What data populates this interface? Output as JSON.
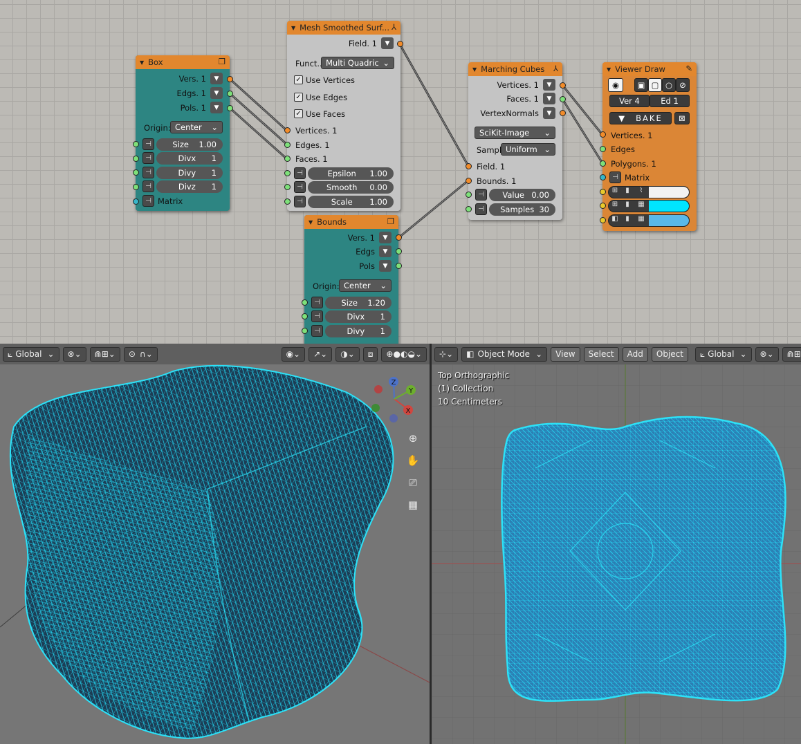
{
  "node_editor": {
    "box": {
      "title": "Box",
      "out_verts": "Vers. 1",
      "out_edges": "Edgs. 1",
      "out_pols": "Pols. 1",
      "origin_label": "Origin:",
      "origin_value": "Center",
      "fields": [
        {
          "label": "Size",
          "value": "1.00"
        },
        {
          "label": "Divx",
          "value": "1"
        },
        {
          "label": "Divy",
          "value": "1"
        },
        {
          "label": "Divz",
          "value": "1"
        }
      ],
      "matrix_label": "Matrix"
    },
    "mesh_smoothed": {
      "title": "Mesh Smoothed Surf...",
      "out_field": "Field. 1",
      "func_label": "Funct..",
      "func_value": "Multi Quadric",
      "use_vertices": "Use Vertices",
      "use_edges": "Use Edges",
      "use_faces": "Use Faces",
      "in_vertices": "Vertices. 1",
      "in_edges": "Edges. 1",
      "in_faces": "Faces. 1",
      "fields": [
        {
          "label": "Epsilon",
          "value": "1.00"
        },
        {
          "label": "Smooth",
          "value": "0.00"
        },
        {
          "label": "Scale",
          "value": "1.00"
        }
      ]
    },
    "bounds": {
      "title": "Bounds",
      "out_verts": "Vers. 1",
      "out_edges": "Edgs",
      "out_pols": "Pols",
      "origin_label": "Origin:",
      "origin_value": "Center",
      "fields": [
        {
          "label": "Size",
          "value": "1.20"
        },
        {
          "label": "Divx",
          "value": "1"
        },
        {
          "label": "Divy",
          "value": "1"
        }
      ]
    },
    "marching_cubes": {
      "title": "Marching Cubes",
      "out_vertices": "Vertices. 1",
      "out_faces": "Faces. 1",
      "out_normals": "VertexNormals",
      "impl_value": "SciKit-Image",
      "sample_label": "Sampl",
      "sample_value": "Uniform",
      "in_field": "Field. 1",
      "in_bounds": "Bounds. 1",
      "fields": [
        {
          "label": "Value",
          "value": "0.00"
        },
        {
          "label": "Samples",
          "value": "30"
        }
      ]
    },
    "viewer_draw": {
      "title": "Viewer Draw",
      "ver_label": "Ver 4",
      "ed_label": "Ed  1",
      "bake_label": "BAKE",
      "in_vertices": "Vertices. 1",
      "in_edges": "Edges",
      "in_polygons": "Polygons. 1",
      "in_matrix": "Matrix",
      "colors": {
        "vert": "#f2f2f2",
        "edge": "#00e5ff",
        "poly": "#5ab8e8"
      }
    }
  },
  "viewport_left": {
    "header": {
      "orientation": "Global"
    },
    "gizmo": {
      "z": "Z",
      "y": "Y",
      "x": "X"
    }
  },
  "viewport_right": {
    "header": {
      "mode": "Object Mode",
      "view": "View",
      "select": "Select",
      "add": "Add",
      "object": "Object",
      "orientation": "Global"
    },
    "overlay": {
      "view_name": "Top Orthographic",
      "collection": "(1) Collection",
      "scale": "10 Centimeters"
    }
  },
  "colors": {
    "wire": "#1fdcf5",
    "mesh_fill": "#2a84b8",
    "node_header": "#e2872e",
    "node_teal": "#2d8582"
  }
}
